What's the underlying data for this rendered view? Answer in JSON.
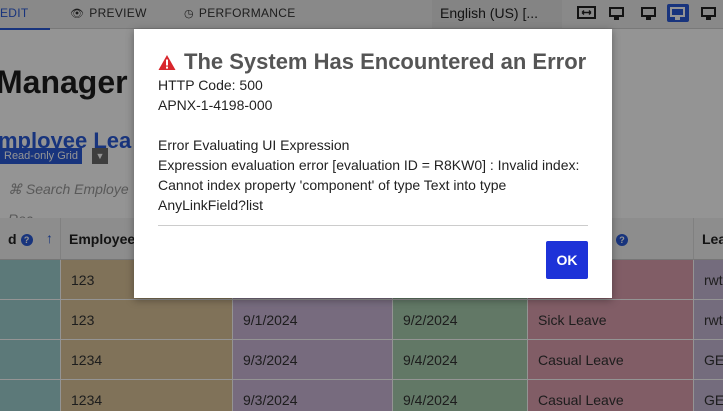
{
  "toolbar": {
    "tabs": {
      "edit": "EDIT",
      "preview": "PREVIEW",
      "performance": "PERFORMANCE"
    },
    "language": "English (US) [..."
  },
  "background": {
    "page_title": "Manager A",
    "grid_title": "mployee Lea",
    "grid_type_label": "Read-only Grid",
    "search_placeholder": "Search Employe Rec",
    "columns": [
      "d",
      "Employee",
      "",
      "",
      "",
      "Lea"
    ],
    "rows": [
      [
        "",
        "123",
        "",
        "",
        "",
        "rwt"
      ],
      [
        "",
        "123",
        "9/1/2024",
        "9/2/2024",
        "Sick Leave",
        "rwt"
      ],
      [
        "",
        "1234",
        "9/3/2024",
        "9/4/2024",
        "Casual Leave",
        "GE"
      ],
      [
        "",
        "1234",
        "9/3/2024",
        "9/4/2024",
        "Casual Leave",
        "GE"
      ]
    ],
    "colors": {
      "c0": "#9fd0d0",
      "c1": "#dcc49a",
      "c2": "#cdb8da",
      "c3": "#a9cfb0",
      "c4": "#dfa0b0",
      "c5": "#c8bad8"
    }
  },
  "dialog": {
    "title": "The System Has Encountered an Error",
    "http_code": "HTTP Code: 500",
    "error_id": "APNX-1-4198-000",
    "heading": "Error Evaluating UI Expression",
    "message": "Expression evaluation error [evaluation ID = R8KW0] : Invalid index: Cannot index property 'component' of type Text into type AnyLinkField?list",
    "ok_label": "OK",
    "colors": {
      "warning": "#d8262c",
      "ok_button": "#1d32d8"
    }
  }
}
